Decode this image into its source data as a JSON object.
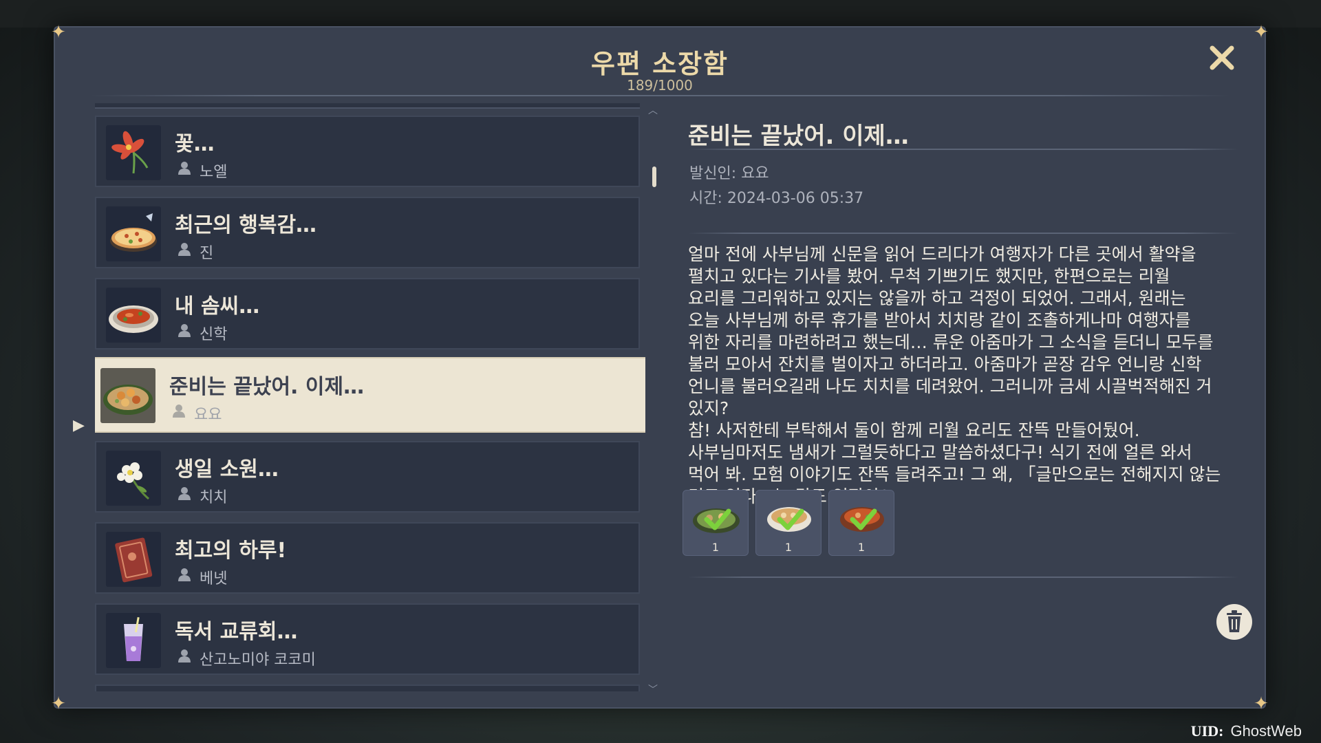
{
  "modal": {
    "title": "우편 소장함",
    "count": "189/1000"
  },
  "mail_list": [
    {
      "title": "꽃…",
      "sender": "노엘",
      "thumb": "flower-icon"
    },
    {
      "title": "최근의 행복감…",
      "sender": "진",
      "thumb": "pizza-icon"
    },
    {
      "title": "내 솜씨…",
      "sender": "신학",
      "thumb": "dish-icon"
    },
    {
      "title": "준비는 끝났어. 이제…",
      "sender": "요요",
      "thumb": "food-plate-icon",
      "selected": true
    },
    {
      "title": "생일 소원…",
      "sender": "치치",
      "thumb": "white-flower-icon"
    },
    {
      "title": "최고의 하루!",
      "sender": "베넷",
      "thumb": "book-icon"
    },
    {
      "title": "독서 교류회…",
      "sender": "산고노미야 코코미",
      "thumb": "drink-icon"
    }
  ],
  "detail": {
    "title": "준비는 끝났어. 이제…",
    "sender_line": "발신인: 요요",
    "time_line": "시간: 2024-03-06 05:37",
    "body": "얼마 전에 사부님께 신문을 읽어 드리다가 여행자가 다른 곳에서 활약을\n펼치고 있다는 기사를 봤어. 무척 기쁘기도 했지만, 한편으로는 리월\n요리를 그리워하고 있지는 않을까 하고 걱정이 되었어. 그래서, 원래는\n오늘 사부님께 하루 휴가를 받아서 치치랑 같이 조촐하게나마 여행자를\n위한 자리를 마련하려고 했는데… 류운 아줌마가 그 소식을 듣더니 모두를\n불러 모아서 잔치를 벌이자고 하더라고. 아줌마가 곧장 감우 언니랑 신학\n언니를 불러오길래 나도 치치를 데려왔어. 그러니까 금세 시끌벅적해진 거\n있지?\n참! 사저한테 부탁해서 둘이 함께 리월 요리도 잔뜩 만들어뒀어.\n사부님마저도 냄새가 그럴듯하다고 말씀하셨다구! 식기 전에 얼른 와서\n먹어 봐. 모험 이야기도 잔뜩 들려주고! 그 왜, 「글만으로는 전해지지 않는\n것도 있다」는 말도 있잖아?",
    "attachments": [
      {
        "name": "dish-attachment-1",
        "qty": "1"
      },
      {
        "name": "dish-attachment-2",
        "qty": "1"
      },
      {
        "name": "dish-attachment-3",
        "qty": "1"
      }
    ]
  },
  "uid": {
    "label": "UID:",
    "value": "GhostWeb"
  },
  "colors": {
    "panel": "#39404f",
    "item": "#2c3342",
    "selected": "#ece5d3",
    "gold": "#ecd9a9",
    "check": "#7cd13c"
  }
}
